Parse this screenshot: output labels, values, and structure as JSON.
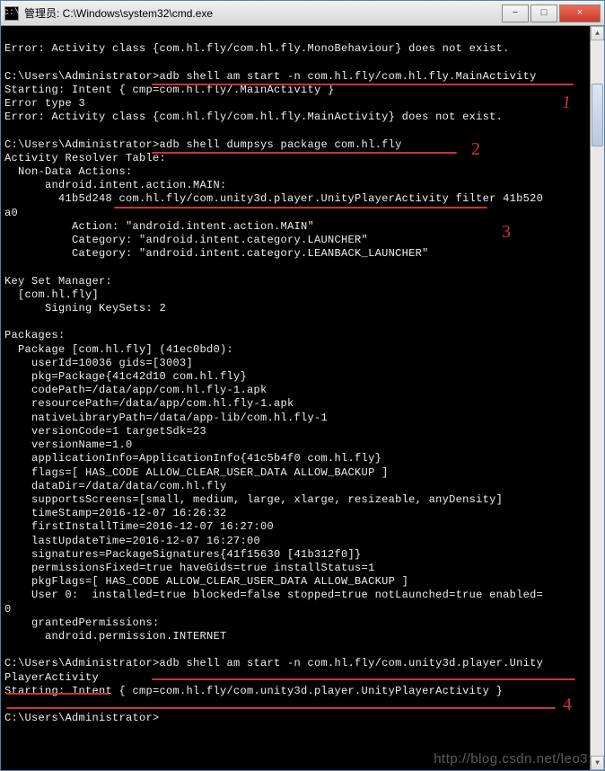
{
  "window": {
    "title": "管理员: C:\\Windows\\system32\\cmd.exe",
    "icon_text": "c:\\"
  },
  "buttons": {
    "minimize": "−",
    "maximize": "□",
    "close": "×"
  },
  "scrollbar": {
    "up": "▲",
    "down": "▼"
  },
  "terminal": {
    "lines": [
      "",
      "Error: Activity class {com.hl.fly/com.hl.fly.MonoBehaviour} does not exist.",
      "",
      "C:\\Users\\Administrator>adb shell am start -n com.hl.fly/com.hl.fly.MainActivity",
      "Starting: Intent { cmp=com.hl.fly/.MainActivity }",
      "Error type 3",
      "Error: Activity class {com.hl.fly/com.hl.fly.MainActivity} does not exist.",
      "",
      "C:\\Users\\Administrator>adb shell dumpsys package com.hl.fly",
      "Activity Resolver Table:",
      "  Non-Data Actions:",
      "      android.intent.action.MAIN:",
      "        41b5d248 com.hl.fly/com.unity3d.player.UnityPlayerActivity filter 41b520",
      "a0",
      "          Action: \"android.intent.action.MAIN\"",
      "          Category: \"android.intent.category.LAUNCHER\"",
      "          Category: \"android.intent.category.LEANBACK_LAUNCHER\"",
      "",
      "Key Set Manager:",
      "  [com.hl.fly]",
      "      Signing KeySets: 2",
      "",
      "Packages:",
      "  Package [com.hl.fly] (41ec0bd0):",
      "    userId=10036 gids=[3003]",
      "    pkg=Package{41c42d10 com.hl.fly}",
      "    codePath=/data/app/com.hl.fly-1.apk",
      "    resourcePath=/data/app/com.hl.fly-1.apk",
      "    nativeLibraryPath=/data/app-lib/com.hl.fly-1",
      "    versionCode=1 targetSdk=23",
      "    versionName=1.0",
      "    applicationInfo=ApplicationInfo{41c5b4f0 com.hl.fly}",
      "    flags=[ HAS_CODE ALLOW_CLEAR_USER_DATA ALLOW_BACKUP ]",
      "    dataDir=/data/data/com.hl.fly",
      "    supportsScreens=[small, medium, large, xlarge, resizeable, anyDensity]",
      "    timeStamp=2016-12-07 16:26:32",
      "    firstInstallTime=2016-12-07 16:27:00",
      "    lastUpdateTime=2016-12-07 16:27:00",
      "    signatures=PackageSignatures{41f15630 [41b312f0]}",
      "    permissionsFixed=true haveGids=true installStatus=1",
      "    pkgFlags=[ HAS_CODE ALLOW_CLEAR_USER_DATA ALLOW_BACKUP ]",
      "    User 0:  installed=true blocked=false stopped=true notLaunched=true enabled=",
      "0",
      "    grantedPermissions:",
      "      android.permission.INTERNET",
      "",
      "C:\\Users\\Administrator>adb shell am start -n com.hl.fly/com.unity3d.player.Unity",
      "PlayerActivity",
      "Starting: Intent { cmp=com.hl.fly/com.unity3d.player.UnityPlayerActivity }",
      "",
      "C:\\Users\\Administrator>"
    ]
  },
  "annotations": {
    "num1": "1",
    "num2": "2",
    "num3": "3",
    "num4": "4"
  },
  "watermark": "http://blog.csdn.net/leo3"
}
